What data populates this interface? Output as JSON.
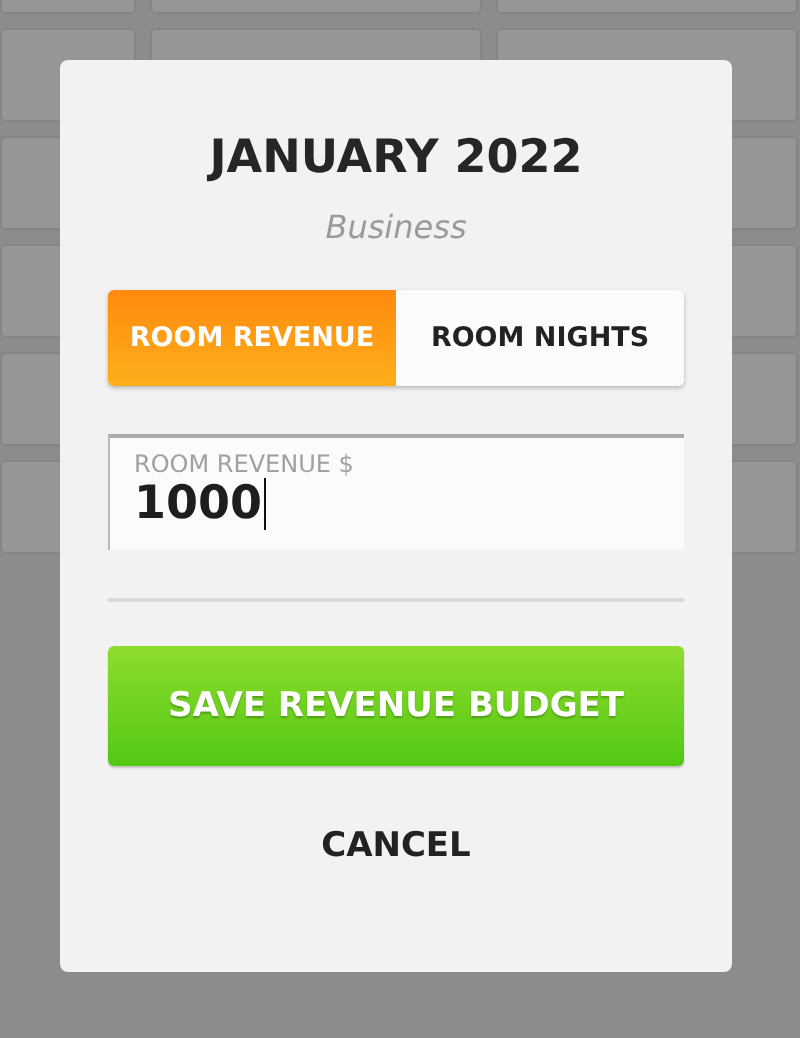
{
  "dialog": {
    "title": "JANUARY 2022",
    "subtitle": "Business",
    "tabs": [
      {
        "label": "ROOM REVENUE",
        "selected": true
      },
      {
        "label": "ROOM NIGHTS",
        "selected": false
      }
    ],
    "field": {
      "label": "ROOM REVENUE $",
      "value": "1000"
    },
    "buttons": [
      {
        "kind": "primary",
        "label": "SAVE REVENUE BUDGET"
      },
      {
        "kind": "text",
        "label": "CANCEL"
      }
    ]
  }
}
